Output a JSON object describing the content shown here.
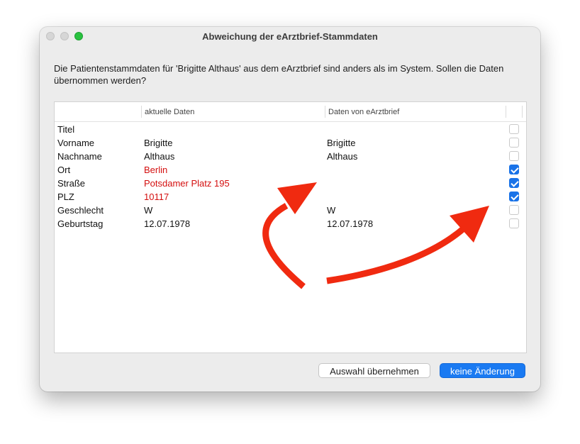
{
  "window": {
    "title": "Abweichung der eArztbrief-Stammdaten",
    "message": "Die Patientenstammdaten für 'Brigitte Althaus' aus dem eArztbrief sind anders als im System. Sollen die Daten übernommen werden?"
  },
  "table": {
    "headers": {
      "field": "",
      "current": "aktuelle Daten",
      "new": "Daten von eArztbrief"
    },
    "rows": [
      {
        "label": "Titel",
        "current": "",
        "new": "",
        "checked": false,
        "differs": false
      },
      {
        "label": "Vorname",
        "current": "Brigitte",
        "new": "Brigitte",
        "checked": false,
        "differs": false
      },
      {
        "label": "Nachname",
        "current": "Althaus",
        "new": "Althaus",
        "checked": false,
        "differs": false
      },
      {
        "label": "Ort",
        "current": "Berlin",
        "new": "",
        "checked": true,
        "differs": true
      },
      {
        "label": "Straße",
        "current": "Potsdamer Platz 195",
        "new": "",
        "checked": true,
        "differs": true
      },
      {
        "label": "PLZ",
        "current": "10117",
        "new": "",
        "checked": true,
        "differs": true
      },
      {
        "label": "Geschlecht",
        "current": "W",
        "new": "W",
        "checked": false,
        "differs": false
      },
      {
        "label": "Geburtstag",
        "current": "12.07.1978",
        "new": "12.07.1978",
        "checked": false,
        "differs": false
      }
    ]
  },
  "buttons": {
    "apply": "Auswahl übernehmen",
    "no_change": "keine Änderung"
  },
  "colors": {
    "accent": "#1a7af2",
    "difference": "#d40f0f",
    "annotation_arrow": "#f02a10"
  }
}
